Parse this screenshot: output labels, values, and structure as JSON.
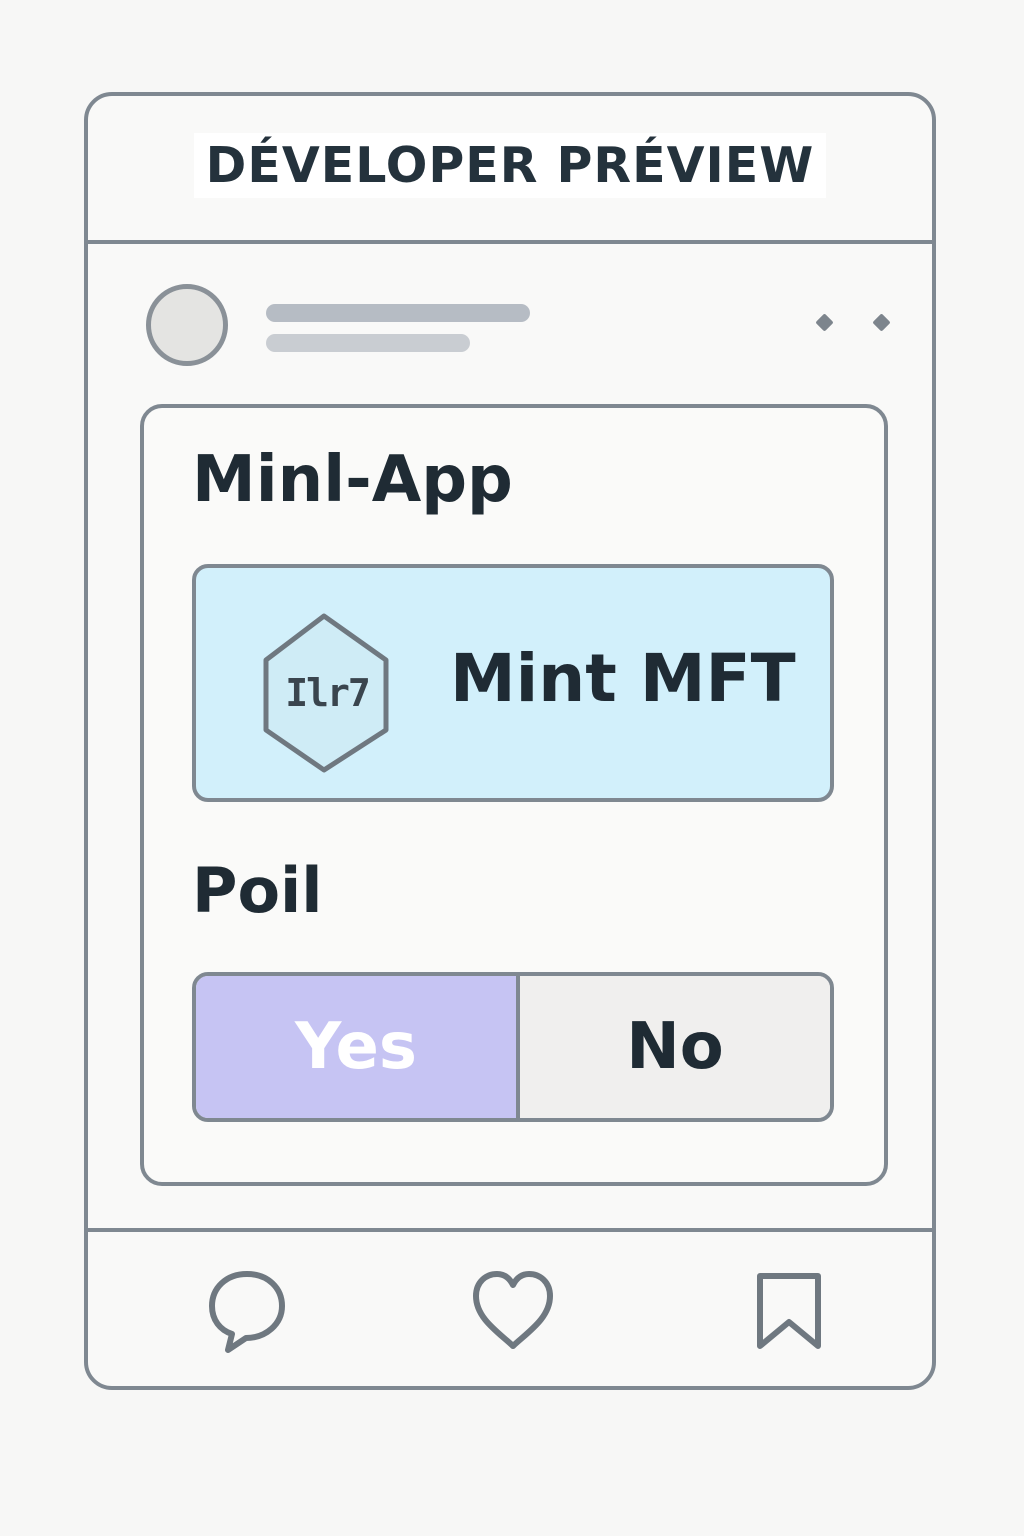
{
  "header": {
    "title": "DÉVELOPER PRÉVIEW"
  },
  "post": {
    "more_icon": "more-dots-icon",
    "avatar_icon": "avatar-placeholder"
  },
  "mini_app": {
    "title": "Minl-App",
    "mint_button": {
      "icon": "nft-hexagon-icon",
      "icon_text": "Ilr7",
      "label": "Mint MFT"
    },
    "poll": {
      "title": "Poil",
      "options": [
        {
          "label": "Yes",
          "selected": true
        },
        {
          "label": "No",
          "selected": false
        }
      ]
    }
  },
  "footer": {
    "actions": [
      {
        "name": "comment",
        "icon": "comment-icon"
      },
      {
        "name": "like",
        "icon": "heart-icon"
      },
      {
        "name": "bookmark",
        "icon": "bookmark-icon"
      }
    ]
  },
  "colors": {
    "border": "#7f8891",
    "mint_button_bg": "#d2f0fb",
    "poll_yes_bg": "#c6c4f3",
    "poll_no_bg": "#f0efee",
    "text_dark": "#1f2b34"
  }
}
